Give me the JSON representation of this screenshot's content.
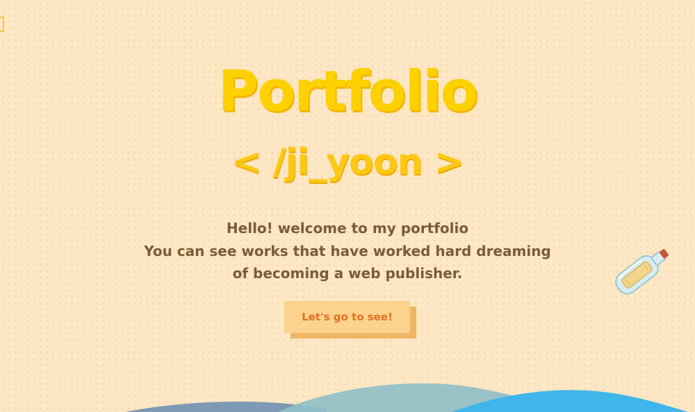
{
  "hero": {
    "title": "Portfolio",
    "subtitle": "< /ji_yoon >",
    "intro_lines": [
      "Hello! welcome to my portfolio",
      "You can see works that have worked hard dreaming",
      "of becoming a web publisher."
    ],
    "cta_label": "Let's go to see!"
  },
  "decorations": {
    "bottle_icon": "message-in-a-bottle-icon",
    "waves": "ocean-waves"
  },
  "colors": {
    "background": "#fde7c4",
    "title": "#fdd100",
    "subtitle": "#fcc813",
    "body_text": "#7b5b38",
    "button_face": "#fbd38f",
    "button_side": "#efb765",
    "button_text": "#e1711e",
    "wave_teal": "#8fbfc8",
    "wave_blue": "#3fb6ea",
    "wave_slate": "#7e99b4"
  }
}
